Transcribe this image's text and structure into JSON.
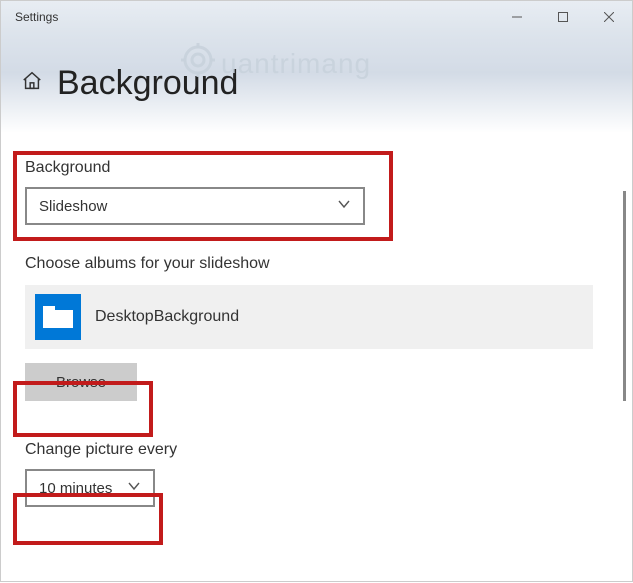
{
  "window": {
    "title": "Settings"
  },
  "header": {
    "title": "Background"
  },
  "watermark": {
    "text": "uantrimang"
  },
  "background": {
    "label": "Background",
    "selected": "Slideshow"
  },
  "albums": {
    "label": "Choose albums for your slideshow",
    "folder_name": "DesktopBackground",
    "browse_label": "Browse"
  },
  "interval": {
    "label": "Change picture every",
    "selected": "10 minutes"
  }
}
